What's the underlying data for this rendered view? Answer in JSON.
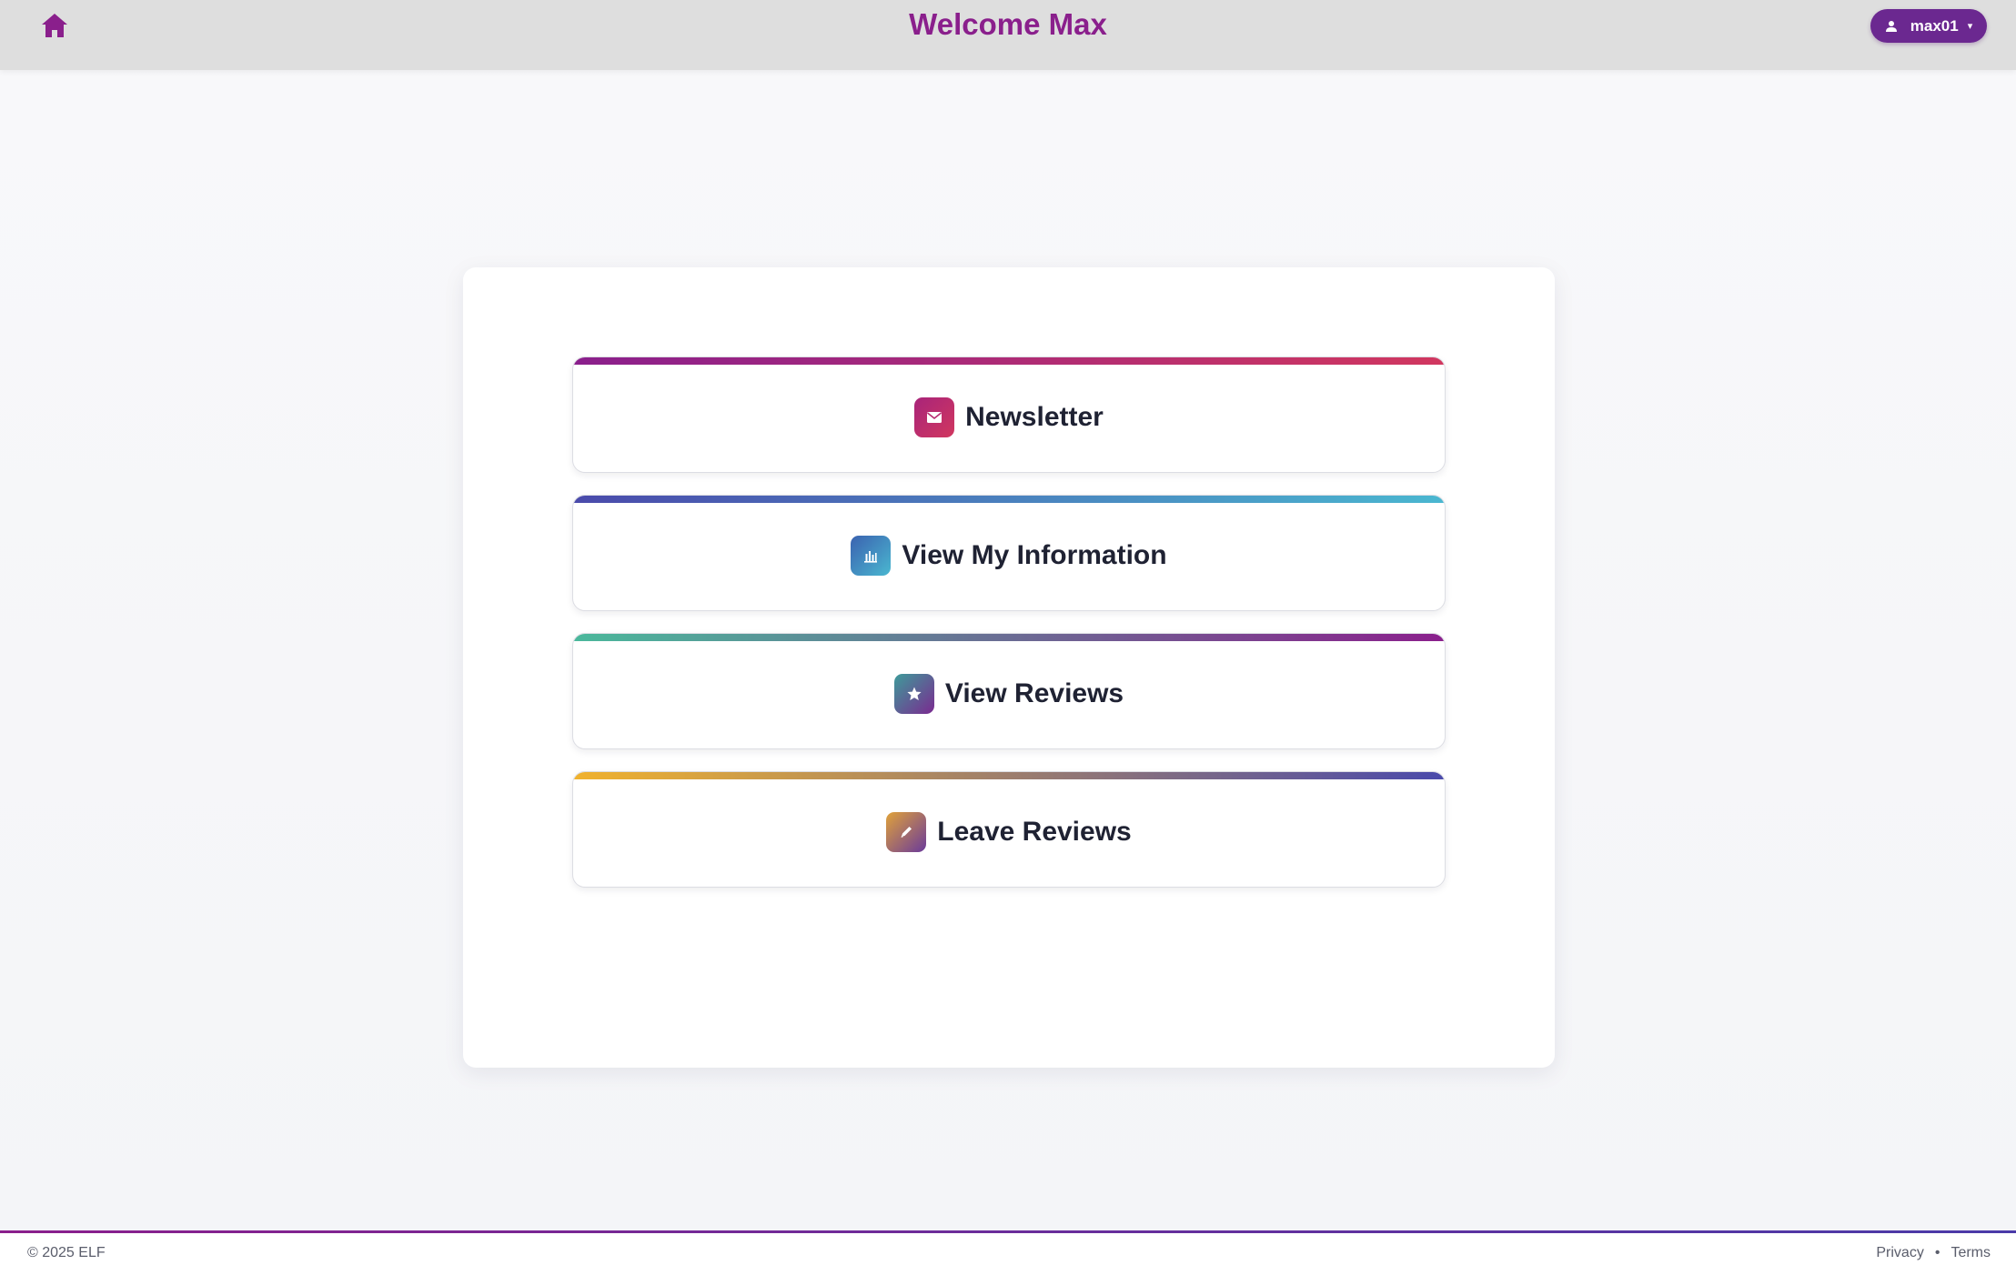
{
  "header": {
    "title": "Welcome Max",
    "home_icon": "home-icon",
    "user": {
      "name": "max01",
      "icon": "user-icon",
      "caret": "▾"
    }
  },
  "menu": [
    {
      "label": "Newsletter",
      "icon": "mail-icon",
      "bar_colors": [
        "#8a1f8c",
        "#d1375f"
      ],
      "icon_colors": [
        "#a8247a",
        "#d1375f"
      ]
    },
    {
      "label": "View My Information",
      "icon": "bar-chart-icon",
      "bar_colors": [
        "#4a4aab",
        "#4ab7d0"
      ],
      "icon_colors": [
        "#3b62b0",
        "#4ab7d0"
      ]
    },
    {
      "label": "View Reviews",
      "icon": "star-icon",
      "bar_colors": [
        "#4ab89b",
        "#8a1f8c"
      ],
      "icon_colors": [
        "#3e9b9a",
        "#7a2a90"
      ]
    },
    {
      "label": "Leave Reviews",
      "icon": "pencil-icon",
      "bar_colors": [
        "#f0b22e",
        "#4a4aab"
      ],
      "icon_colors": [
        "#e0a23a",
        "#6a3a9a"
      ]
    }
  ],
  "footer": {
    "copyright": "© 2025 ELF",
    "links": [
      "Privacy",
      "Terms"
    ],
    "separator": "•"
  },
  "colors": {
    "brand": "#8a1f8c",
    "user_button": "#6b2890",
    "header_bg": "#dedede"
  }
}
